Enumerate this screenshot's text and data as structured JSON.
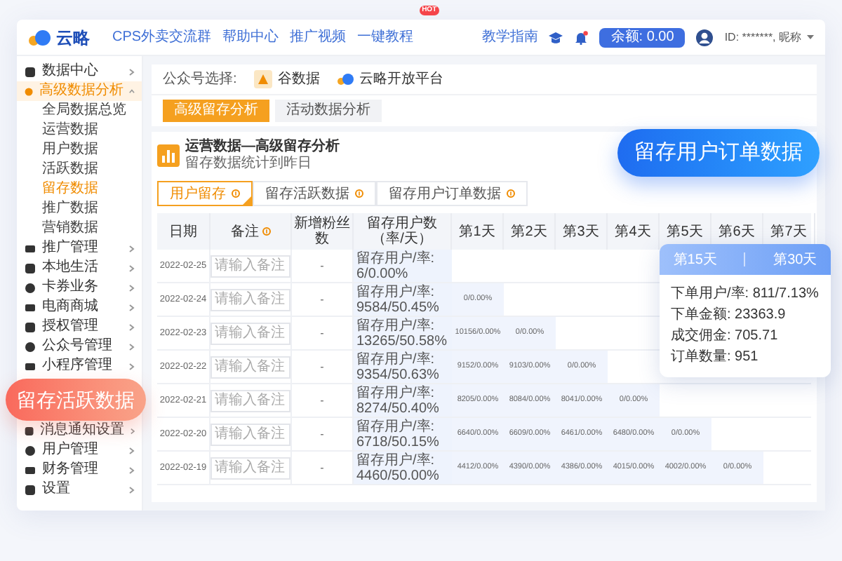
{
  "header": {
    "logo": "云略",
    "nav": [
      {
        "label": "CPS外卖交流群"
      },
      {
        "label": "帮助中心"
      },
      {
        "label": "推广视频"
      },
      {
        "label": "一键教程",
        "badge": "HOT"
      }
    ],
    "guide": "教学指南",
    "balance": "余额: 0.00",
    "user": "ID: *******, 昵称"
  },
  "sidebar": {
    "items": [
      {
        "label": "数据中心",
        "selected": false,
        "expanded": false
      },
      {
        "label": "高级数据分析",
        "selected": true,
        "expanded": true,
        "children": [
          {
            "label": "全局数据总览",
            "selected": false
          },
          {
            "label": "运营数据",
            "selected": false
          },
          {
            "label": "用户数据",
            "selected": false
          },
          {
            "label": "活跃数据",
            "selected": false
          },
          {
            "label": "留存数据",
            "selected": true
          },
          {
            "label": "推广数据",
            "selected": false
          },
          {
            "label": "营销数据",
            "selected": false
          }
        ]
      },
      {
        "label": "推广管理",
        "selected": false,
        "expanded": false
      },
      {
        "label": "本地生活",
        "selected": false,
        "expanded": false
      },
      {
        "label": "卡券业务",
        "selected": false,
        "expanded": false
      },
      {
        "label": "电商商城",
        "selected": false,
        "expanded": false
      },
      {
        "label": "授权管理",
        "selected": false,
        "expanded": false
      },
      {
        "label": "公众号管理",
        "selected": false,
        "expanded": false
      },
      {
        "label": "小程序管理",
        "selected": false,
        "expanded": false
      },
      {
        "label": "消息通知设置",
        "selected": false,
        "expanded": false
      },
      {
        "label": "用户管理",
        "selected": false,
        "expanded": false
      },
      {
        "label": "财务管理",
        "selected": false,
        "expanded": false
      },
      {
        "label": "设置",
        "selected": false,
        "expanded": false
      }
    ]
  },
  "account": {
    "label": "公众号选择:",
    "options": [
      {
        "label": "谷数据",
        "selected": true
      },
      {
        "label": "云略开放平台",
        "selected": false
      }
    ]
  },
  "tabs": [
    {
      "label": "高级留存分析",
      "selected": true
    },
    {
      "label": "活动数据分析",
      "selected": false
    }
  ],
  "title": "运营数据—高级留存分析",
  "subtitle": "留存数据统计到昨日",
  "table_tabs": [
    {
      "label": "用户留存",
      "selected": true
    },
    {
      "label": "留存活跃数据",
      "selected": false
    },
    {
      "label": "留存用户订单数据",
      "selected": false
    }
  ],
  "table": {
    "columns": [
      {
        "label": "日期",
        "hint": false
      },
      {
        "label": "备注",
        "hint": true
      },
      {
        "label": "新增粉丝数",
        "hint": false
      },
      {
        "label": "留存用户数（率/天）",
        "hint": false
      },
      {
        "label": "第1天",
        "hint": false
      },
      {
        "label": "第2天",
        "hint": false
      },
      {
        "label": "第3天",
        "hint": false
      },
      {
        "label": "第4天",
        "hint": false
      },
      {
        "label": "第5天",
        "hint": false
      },
      {
        "label": "第6天",
        "hint": false
      },
      {
        "label": "第7天",
        "hint": false
      }
    ],
    "rows": [
      {
        "date": "2022-02-25",
        "note_placeholder": "请输入备注",
        "new_fans": "-",
        "retained": "留存用户/率: 6/0.00%",
        "days": []
      },
      {
        "date": "2022-02-24",
        "note_placeholder": "请输入备注",
        "new_fans": "-",
        "retained": "留存用户/率: 9584/50.45%",
        "days": [
          "0/0.00%"
        ]
      },
      {
        "date": "2022-02-23",
        "note_placeholder": "请输入备注",
        "new_fans": "-",
        "retained": "留存用户/率: 13265/50.58%",
        "days": [
          "10156/0.00%",
          "0/0.00%"
        ]
      },
      {
        "date": "2022-02-22",
        "note_placeholder": "请输入备注",
        "new_fans": "-",
        "retained": "留存用户/率: 9354/50.63%",
        "days": [
          "9152/0.00%",
          "9103/0.00%",
          "0/0.00%"
        ]
      },
      {
        "date": "2022-02-21",
        "note_placeholder": "请输入备注",
        "new_fans": "-",
        "retained": "留存用户/率: 8274/50.40%",
        "days": [
          "8205/0.00%",
          "8084/0.00%",
          "8041/0.00%",
          "0/0.00%"
        ]
      },
      {
        "date": "2022-02-20",
        "note_placeholder": "请输入备注",
        "new_fans": "-",
        "retained": "留存用户/率: 6718/50.15%",
        "days": [
          "6640/0.00%",
          "6609/0.00%",
          "6461/0.00%",
          "6480/0.00%",
          "0/0.00%"
        ]
      },
      {
        "date": "2022-02-19",
        "note_placeholder": "请输入备注",
        "new_fans": "-",
        "retained": "留存用户/率: 4460/50.00%",
        "days": [
          "4412/0.00%",
          "4390/0.00%",
          "4386/0.00%",
          "4015/0.00%",
          "4002/0.00%",
          "0/0.00%"
        ]
      }
    ]
  },
  "order_badge": "留存用户订单数据",
  "active_badge": "留存活跃数据",
  "popup": {
    "tabs": [
      "第15天",
      "第30天"
    ],
    "lines": [
      "下单用户/率: 811/7.13%",
      "下单金额: 23363.9",
      "成交佣金: 705.71",
      "订单数量: 951"
    ]
  }
}
